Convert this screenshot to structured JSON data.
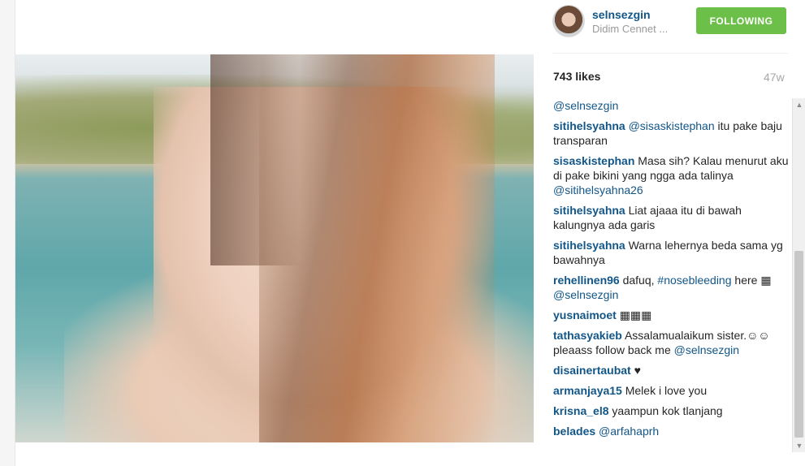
{
  "post": {
    "username": "selnsezgin",
    "location": "Didim Cennet ...",
    "follow_label": "FOLLOWING",
    "likes": "743 likes",
    "time": "47w",
    "photo_alt": "Selfie on a boat"
  },
  "comments": [
    {
      "user": "",
      "mention": "@selnsezgin",
      "text": ""
    },
    {
      "user": "sitihelsyahna",
      "mention": "@sisaskistephan",
      "text": " itu pake baju transparan"
    },
    {
      "user": "sisaskistephan",
      "mention": "",
      "text": "Masa sih? Kalau menurut aku di pake bikini yang ngga ada talinya ",
      "tail_mention": "@sitihelsyahna26"
    },
    {
      "user": "sitihelsyahna",
      "mention": "",
      "text": "Liat ajaaa itu di bawah kalungnya ada garis"
    },
    {
      "user": "sitihelsyahna",
      "mention": "",
      "text": "Warna lehernya beda sama yg bawahnya"
    },
    {
      "user": "rehellinen96",
      "mention": "",
      "text": "dafuq, ",
      "tag": "#nosebleeding",
      "text2": " here ▦ ",
      "tail_mention": "@selnsezgin"
    },
    {
      "user": "yusnaimoet",
      "mention": "",
      "text": "▦▦▦"
    },
    {
      "user": "tathasyakieb",
      "mention": "",
      "text": "Assalamualaikum sister.☺☺pleaass follow back me ",
      "tail_mention": "@selnsezgin"
    },
    {
      "user": "disainertaubat",
      "mention": "",
      "text": "♥"
    },
    {
      "user": "armanjaya15",
      "mention": "",
      "text": "Melek i love you"
    },
    {
      "user": "krisna_el8",
      "mention": "",
      "text": "yaampun kok tlanjang"
    },
    {
      "user": "belades",
      "mention": "@arfahaprh",
      "text": ""
    }
  ],
  "colors": {
    "link": "#125688",
    "follow_bg": "#6cc04a",
    "muted": "#999999"
  },
  "icons": {
    "scroll_up": "up-arrow-icon",
    "scroll_down": "down-arrow-icon"
  }
}
